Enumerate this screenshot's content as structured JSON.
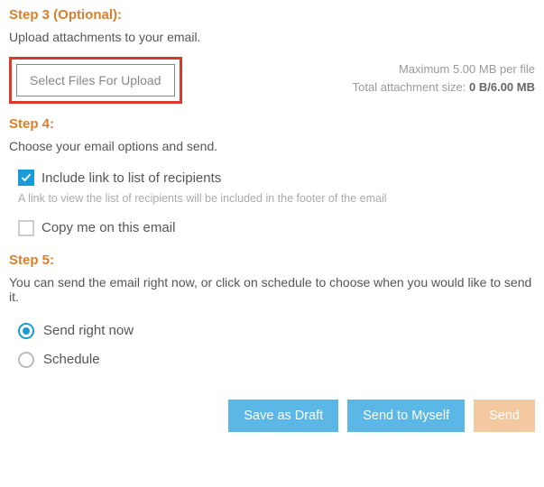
{
  "step3": {
    "heading": "Step 3 (Optional):",
    "desc": "Upload attachments to your email.",
    "select_button": "Select Files For Upload",
    "max_per_file": "Maximum 5.00 MB per file",
    "total_label": "Total attachment size: ",
    "total_value": "0 B/6.00 MB"
  },
  "step4": {
    "heading": "Step 4:",
    "desc": "Choose your email options and send.",
    "include_link_label": "Include link to list of recipients",
    "include_link_hint": "A link to view the list of recipients will be included in the footer of the email",
    "copy_me_label": "Copy me on this email"
  },
  "step5": {
    "heading": "Step 5:",
    "desc": "You can send the email right now, or click on schedule to choose when you would like to send it.",
    "send_now_label": "Send right now",
    "schedule_label": "Schedule"
  },
  "buttons": {
    "save_draft": "Save as Draft",
    "send_myself": "Send to Myself",
    "send": "Send"
  }
}
